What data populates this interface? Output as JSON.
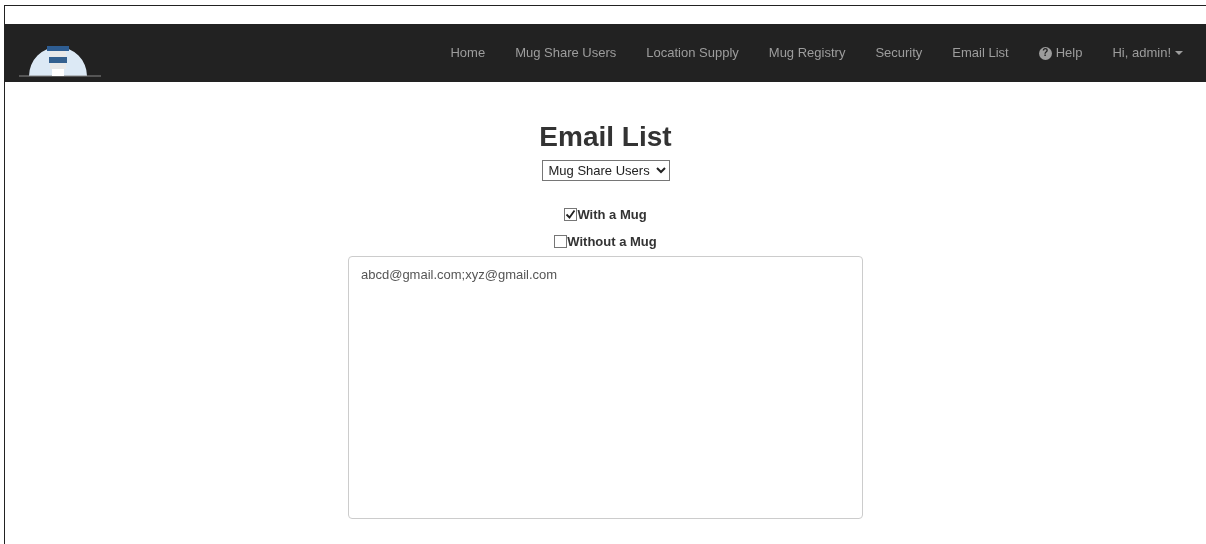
{
  "navbar": {
    "links": [
      {
        "label": "Home"
      },
      {
        "label": "Mug Share Users"
      },
      {
        "label": "Location Supply"
      },
      {
        "label": "Mug Registry"
      },
      {
        "label": "Security"
      },
      {
        "label": "Email List"
      },
      {
        "label": "Help",
        "icon": "?"
      }
    ],
    "user_menu": {
      "label": "Hi, admin!"
    }
  },
  "page": {
    "title": "Email List",
    "filter_select": {
      "value": "Mug Share Users"
    },
    "checkboxes": [
      {
        "label": "With a Mug",
        "checked": true
      },
      {
        "label": "Without a Mug",
        "checked": false
      }
    ],
    "emails": {
      "value": "abcd@gmail.com;xyz@gmail.com"
    }
  }
}
